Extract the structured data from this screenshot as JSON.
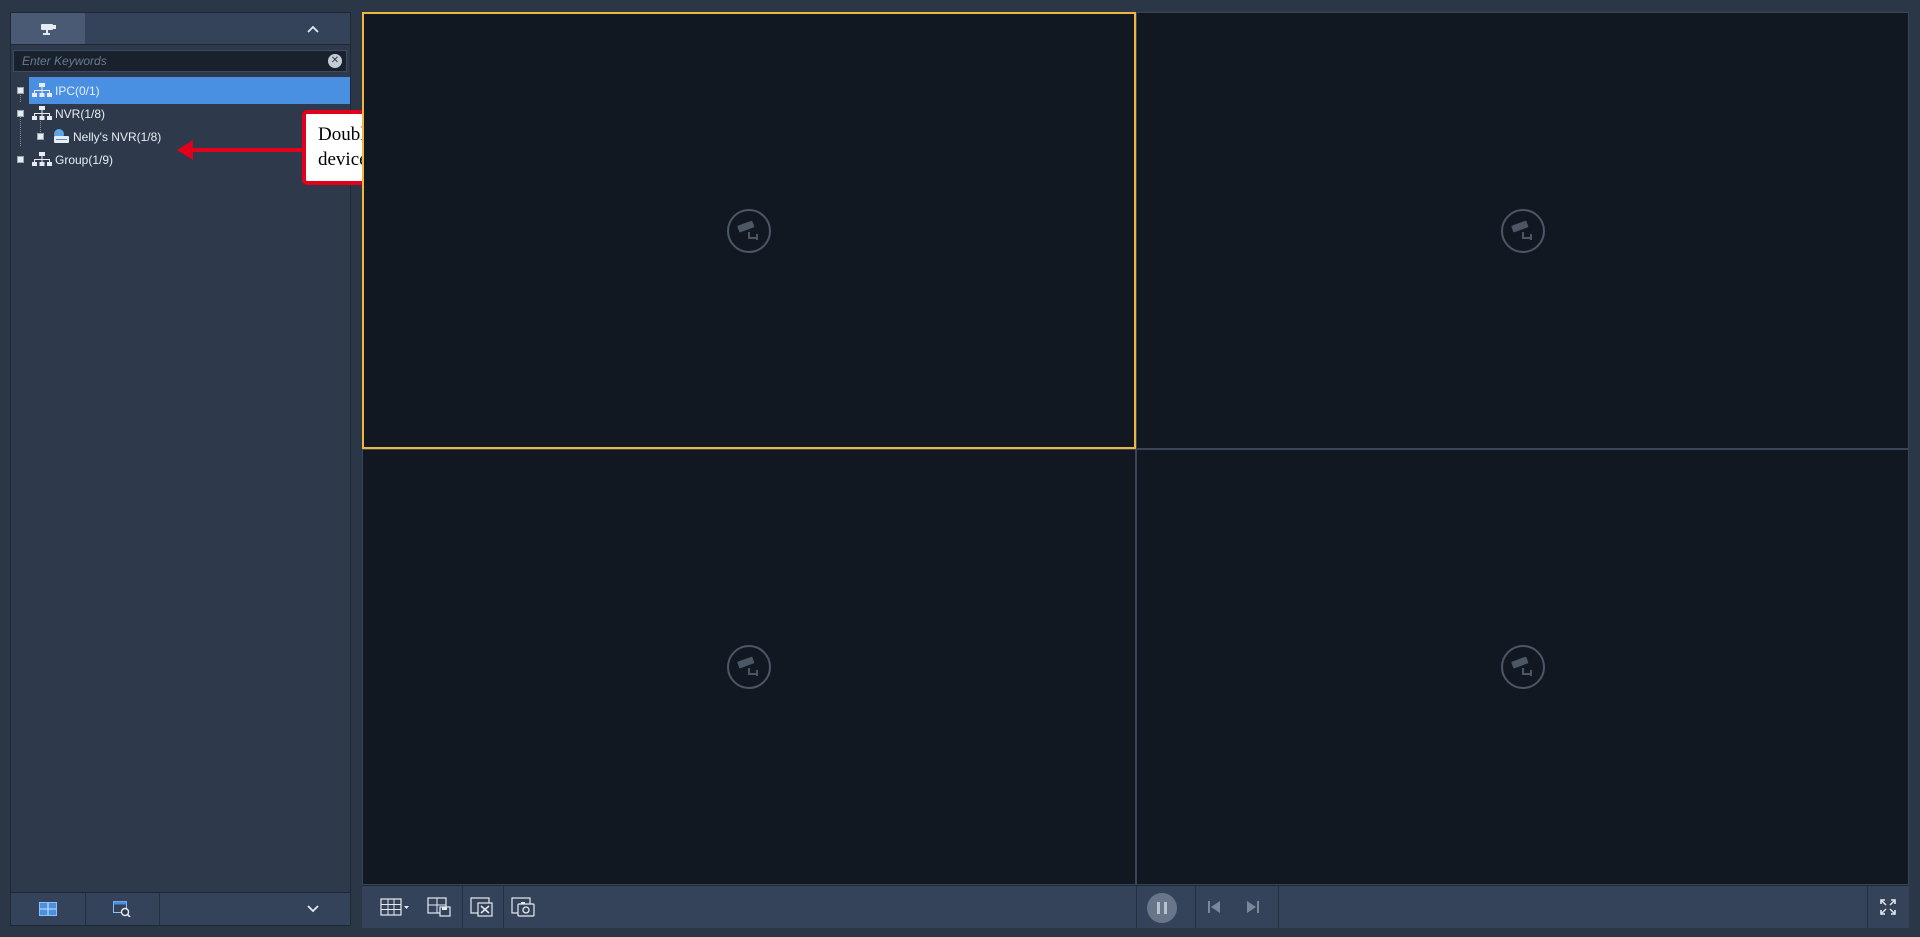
{
  "sidebar": {
    "search": {
      "placeholder": "Enter Keywords",
      "value": ""
    },
    "tree": [
      {
        "label": "IPC(0/1)",
        "selected": true
      },
      {
        "label": "NVR(1/8)",
        "selected": false
      },
      {
        "label": "Nelly's NVR(1/8)",
        "selected": false
      },
      {
        "label": "Group(1/9)",
        "selected": false
      }
    ]
  },
  "callout": {
    "text": "Double click on your device listed."
  },
  "video": {
    "active_cell": 0,
    "layout": "2x2"
  },
  "colors": {
    "selection": "#4a90e2",
    "active_window_border": "#f0b53c",
    "callout_red": "#e3001b"
  }
}
